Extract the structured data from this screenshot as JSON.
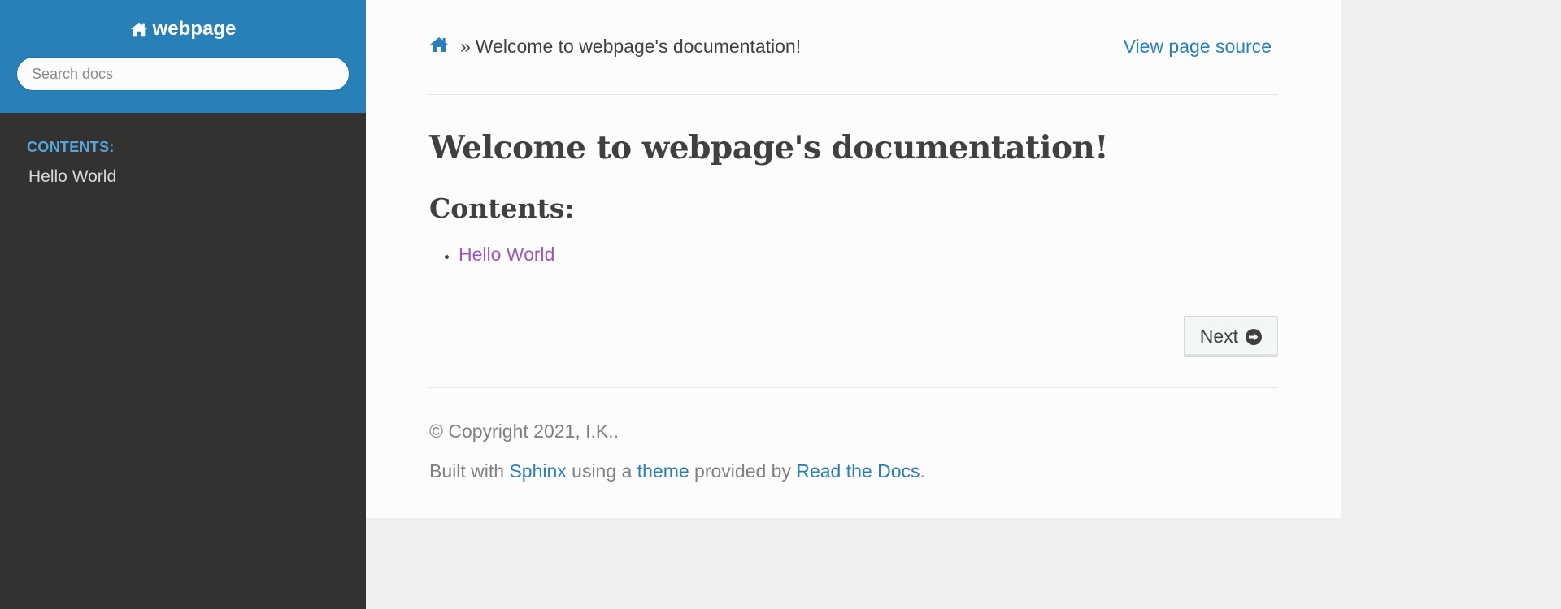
{
  "sidebar": {
    "brand": "webpage",
    "search_placeholder": "Search docs",
    "caption": "CONTENTS:",
    "items": [
      {
        "label": "Hello World"
      }
    ]
  },
  "breadcrumbs": {
    "separator": "»",
    "current": "Welcome to webpage's documentation!",
    "view_source": "View page source"
  },
  "main": {
    "title": "Welcome to webpage's documentation!",
    "contents_heading": "Contents:",
    "toc": [
      {
        "label": "Hello World"
      }
    ],
    "next_label": "Next"
  },
  "footer": {
    "copyright": "© Copyright 2021, I.K..",
    "built_prefix": "Built with",
    "sphinx": "Sphinx",
    "using_a": "using a",
    "theme": "theme",
    "provided_by": "provided by",
    "rtd": "Read the Docs",
    "end": "."
  },
  "colors": {
    "sidebar_top": "#2980b9",
    "sidebar_bg": "#343131",
    "caption": "#55a5d9",
    "link": "#2980b9",
    "visited_link": "#9b59b6",
    "content_bg": "#fcfcfc",
    "page_bg": "#efefef"
  },
  "icons": {
    "brand": "home-icon",
    "breadcrumb_home": "home-icon",
    "next": "arrow-circle-right-icon"
  }
}
